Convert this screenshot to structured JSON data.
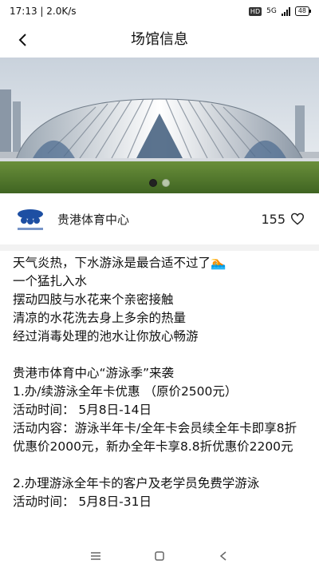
{
  "status_bar": {
    "time_speed": "17:13 | 2.0K/s",
    "hd": "HD",
    "network": "5G",
    "battery": "48"
  },
  "nav": {
    "title": "场馆信息"
  },
  "banner": {
    "slide_count": 2,
    "active_index": 0
  },
  "venue": {
    "name": "贵港体育中心",
    "likes": "155"
  },
  "article": {
    "lines": [
      "天气炎热，下水游泳是最合适不过了🏊",
      "一个猛扎入水",
      "摆动四肢与水花来个亲密接触",
      "清凉的水花洗去身上多余的热量",
      "经过消毒处理的池水让你放心畅游",
      "",
      "贵港市体育中心“游泳季”来袭",
      "1.办/续游泳全年卡优惠 （原价2500元）",
      "活动时间： 5月8日-14日",
      "活动内容：游泳半年卡/全年卡会员续全年卡即享8折优惠价2000元，新办全年卡享8.8折优惠价2200元",
      "",
      "2.办理游泳全年卡的客户及老学员免费学游泳",
      "活动时间： 5月8日-31日"
    ]
  }
}
